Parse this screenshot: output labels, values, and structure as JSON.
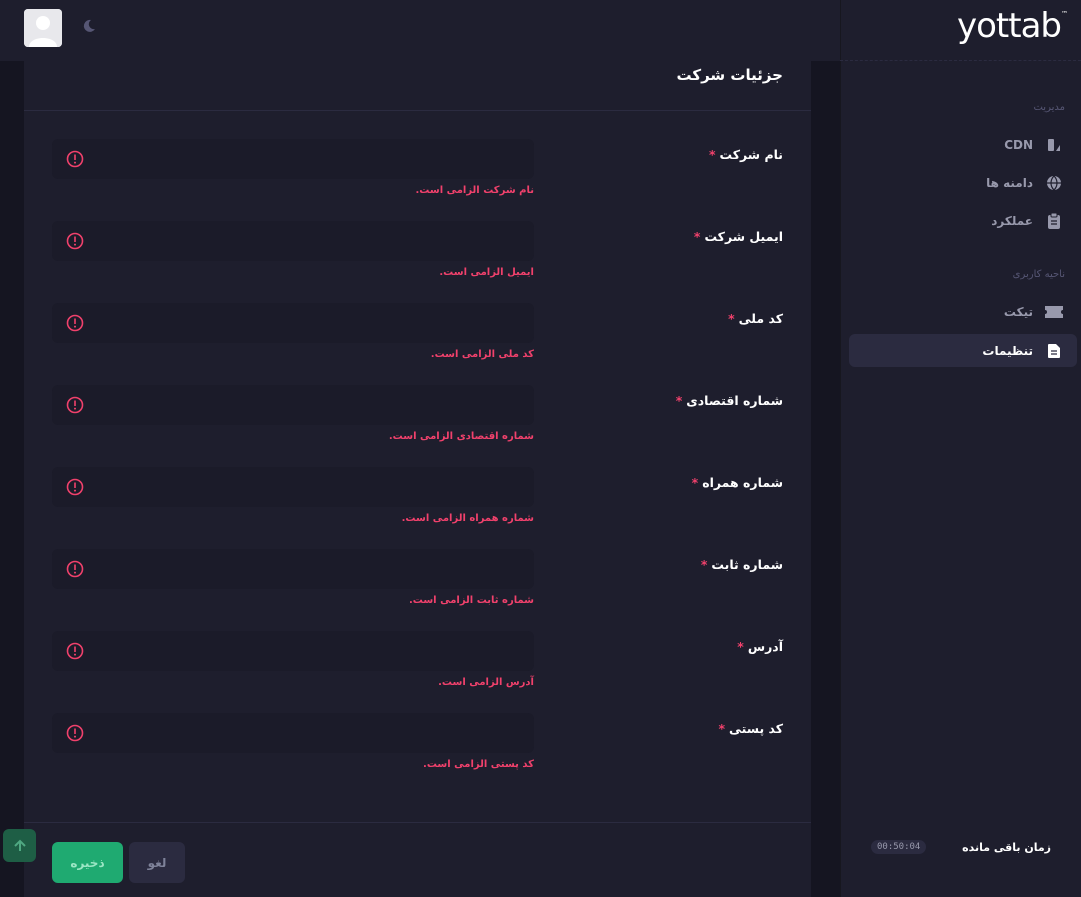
{
  "brand": {
    "logo_text": "yottab",
    "logo_mark": "™"
  },
  "sidebar": {
    "sections": [
      {
        "label": "مدیریت"
      },
      {
        "label": "ناحیه کاربری"
      }
    ],
    "items": [
      {
        "label": "CDN",
        "icon": "cdn-icon",
        "active": false
      },
      {
        "label": "دامنه ها",
        "icon": "globe-icon",
        "active": false
      },
      {
        "label": "عملکرد",
        "icon": "clipboard-icon",
        "active": false
      },
      {
        "label": "تیکت",
        "icon": "ticket-icon",
        "active": false
      },
      {
        "label": "تنظیمات",
        "icon": "document-icon",
        "active": true
      }
    ],
    "timer": {
      "label": "زمان باقی مانده",
      "value": "00:50:04"
    }
  },
  "header": {
    "theme_toggle_icon": "moon-icon",
    "avatar_icon": "avatar-icon"
  },
  "card": {
    "title": "جزئیات شرکت",
    "required_mark": "*",
    "fields": [
      {
        "label": "نام شرکت",
        "value": "",
        "error": "نام شرکت الزامی است."
      },
      {
        "label": "ایمیل شرکت",
        "value": "",
        "error": "ایمیل الزامی است."
      },
      {
        "label": "کد ملی",
        "value": "",
        "error": "کد ملی الزامی است."
      },
      {
        "label": "شماره اقتصادی",
        "value": "",
        "error": "شماره اقتصادی الزامی است."
      },
      {
        "label": "شماره همراه",
        "value": "",
        "error": "شماره همراه الزامی است."
      },
      {
        "label": "شماره ثابت",
        "value": "",
        "error": "شماره ثابت الزامی است."
      },
      {
        "label": "آدرس",
        "value": "",
        "error": "آدرس الزامی است."
      },
      {
        "label": "کد پستی",
        "value": "",
        "error": "کد پستی الزامی است."
      }
    ],
    "buttons": {
      "save": "ذخیره",
      "cancel": "لغو"
    }
  },
  "colors": {
    "accent_green": "#1faa71",
    "error_red": "#f1416c",
    "bg": "#1e1e2d"
  }
}
